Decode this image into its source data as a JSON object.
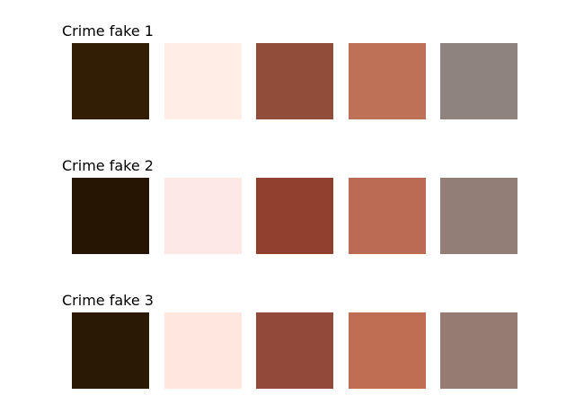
{
  "palettes": [
    {
      "title": "Crime fake 1",
      "colors": [
        "#321d05",
        "#ffede6",
        "#924d3a",
        "#be7157",
        "#8e837e"
      ]
    },
    {
      "title": "Crime fake 2",
      "colors": [
        "#261502",
        "#fde8e6",
        "#913f2f",
        "#bb6a54",
        "#927e76"
      ]
    },
    {
      "title": "Crime fake 3",
      "colors": [
        "#2a1a04",
        "#ffe6de",
        "#92493a",
        "#bf6e54",
        "#957b71"
      ]
    }
  ]
}
